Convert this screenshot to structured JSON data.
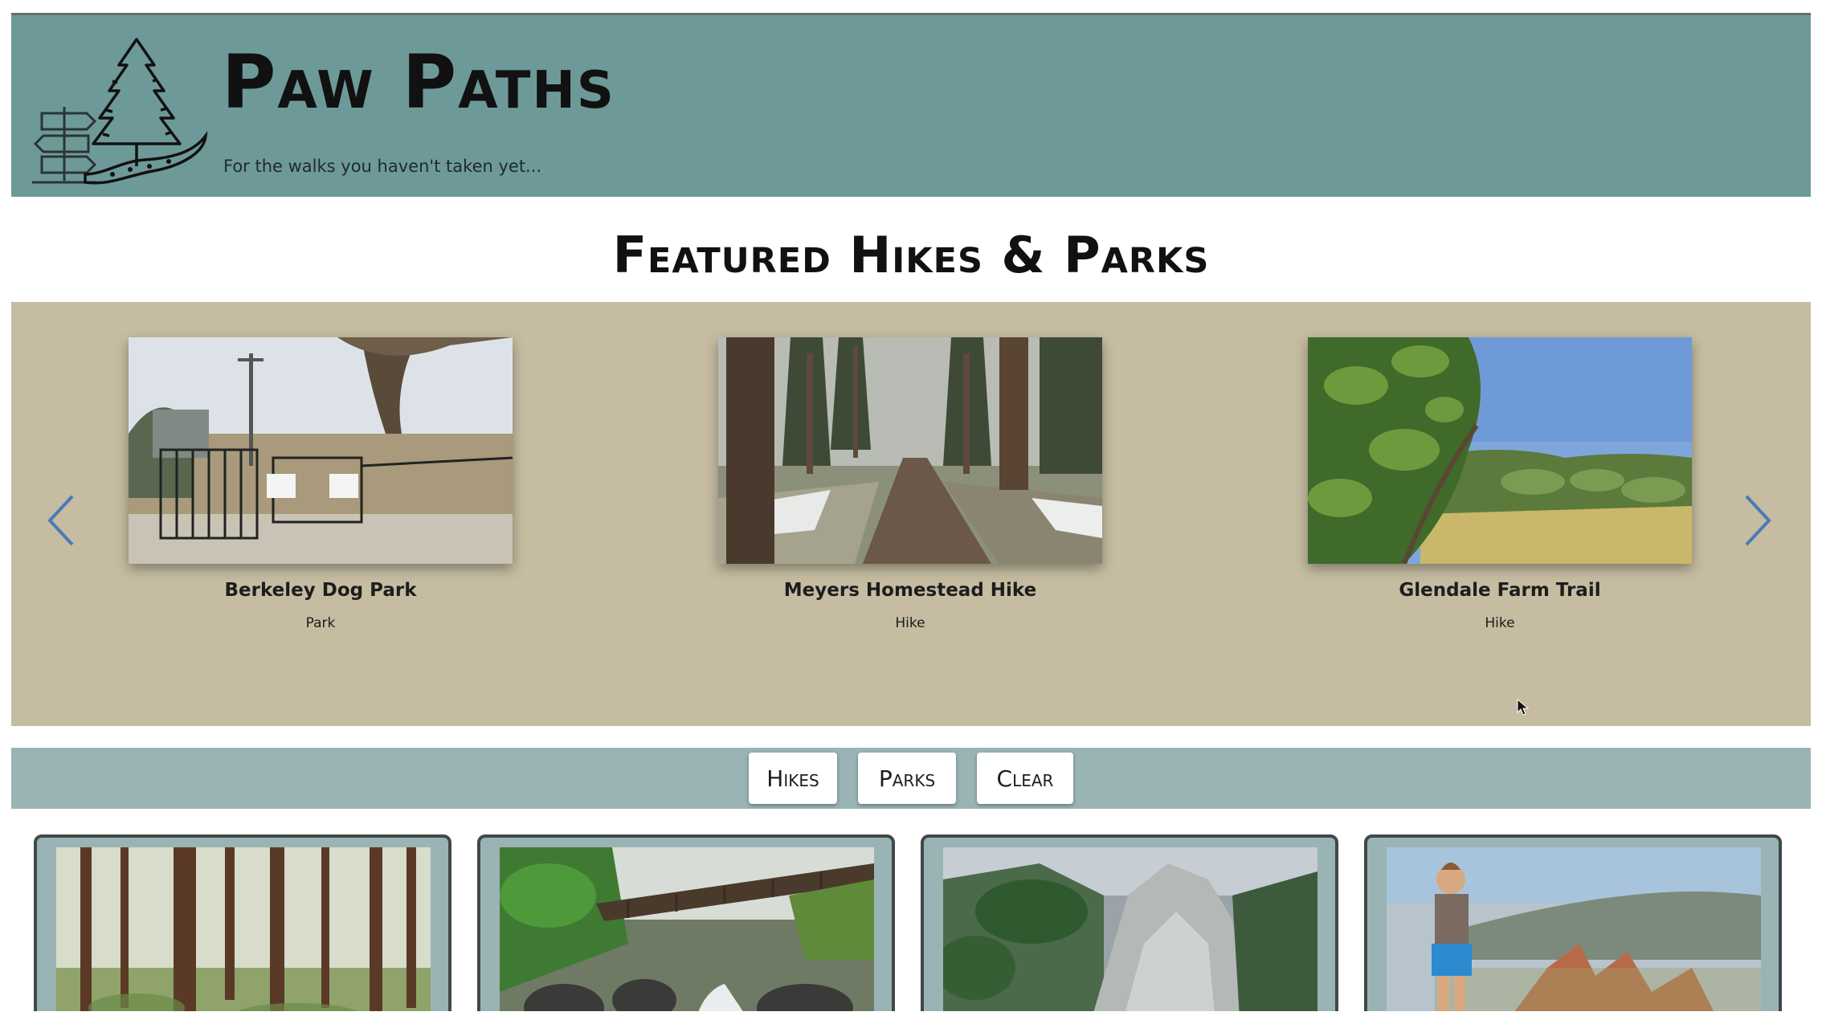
{
  "header": {
    "title": "Paw Paths",
    "tagline": "For the walks you haven't taken yet..."
  },
  "featured": {
    "heading": "Featured Hikes & Parks",
    "cards": [
      {
        "title": "Berkeley Dog Park",
        "type": "Park"
      },
      {
        "title": "Meyers Homestead Hike",
        "type": "Hike"
      },
      {
        "title": "Glendale Farm Trail",
        "type": "Hike"
      }
    ]
  },
  "filters": {
    "hikes": "Hikes",
    "parks": "Parks",
    "clear": "Clear"
  },
  "colors": {
    "header_bg": "#6d9a98",
    "carousel_bg": "#c5bca1",
    "filter_bg": "#9ab4b6",
    "arrow": "#4a7ab8"
  }
}
